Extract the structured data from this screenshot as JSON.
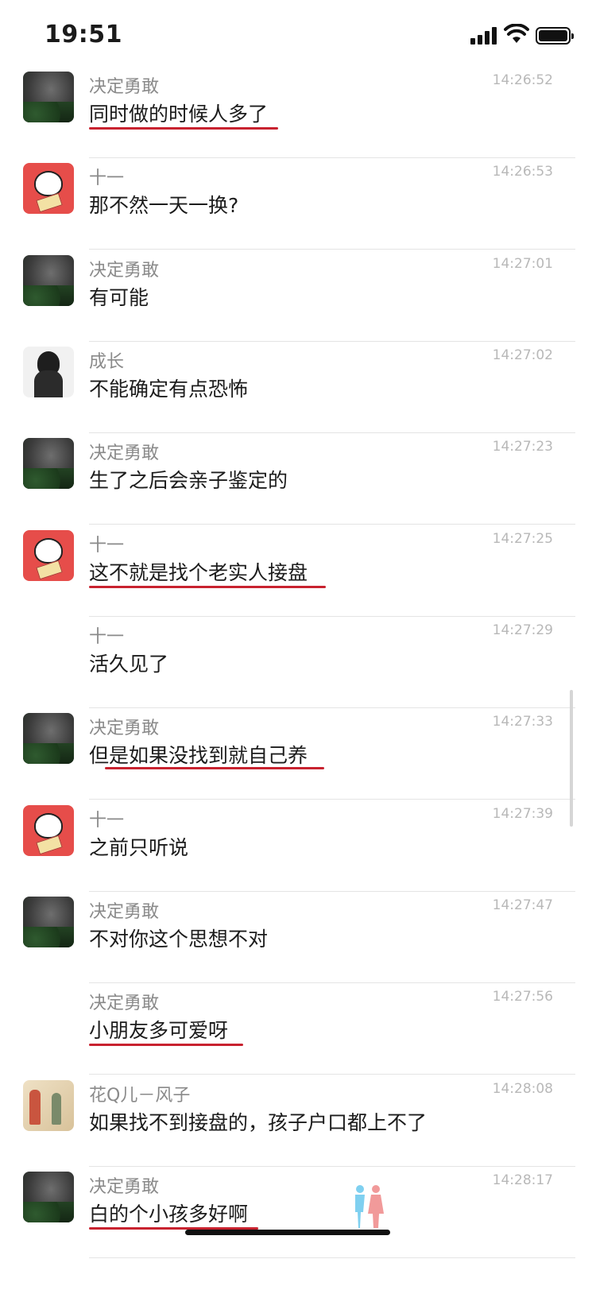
{
  "status": {
    "time": "19:51"
  },
  "messages": [
    {
      "sender": "决定勇敢",
      "time": "14:26:52",
      "text": "同时做的时候人多了",
      "avatar": "night-flower-icon",
      "highlighted": true
    },
    {
      "sender": "十一",
      "time": "14:26:53",
      "text": "那不然一天一换?",
      "avatar": "cartoon-avatar-icon",
      "highlighted": false
    },
    {
      "sender": "决定勇敢",
      "time": "14:27:01",
      "text": "有可能",
      "avatar": "night-flower-icon",
      "highlighted": false
    },
    {
      "sender": "成长",
      "time": "14:27:02",
      "text": "不能确定有点恐怖",
      "avatar": "girl-avatar-icon",
      "highlighted": false
    },
    {
      "sender": "决定勇敢",
      "time": "14:27:23",
      "text": "生了之后会亲子鉴定的",
      "avatar": "night-flower-icon",
      "highlighted": false
    },
    {
      "sender": "十一",
      "time": "14:27:25",
      "text": "这不就是找个老实人接盘",
      "avatar": "cartoon-avatar-icon",
      "highlighted": true
    },
    {
      "sender": "十一",
      "time": "14:27:29",
      "text": "活久见了",
      "avatar": "",
      "highlighted": false
    },
    {
      "sender": "决定勇敢",
      "time": "14:27:33",
      "text": "但是如果没找到就自己养",
      "avatar": "night-flower-icon",
      "highlighted": true
    },
    {
      "sender": "十一",
      "time": "14:27:39",
      "text": "之前只听说",
      "avatar": "cartoon-avatar-icon",
      "highlighted": false
    },
    {
      "sender": "决定勇敢",
      "time": "14:27:47",
      "text": "不对你这个思想不对",
      "avatar": "night-flower-icon",
      "highlighted": false
    },
    {
      "sender": "决定勇敢",
      "time": "14:27:56",
      "text": "小朋友多可爱呀",
      "avatar": "",
      "highlighted": true
    },
    {
      "sender": "花Q儿－风子",
      "time": "14:28:08",
      "text": "如果找不到接盘的，孩子户口都上不了",
      "avatar": "painting-avatar-icon",
      "highlighted": false
    },
    {
      "sender": "决定勇敢",
      "time": "14:28:17",
      "text": "白的个小孩多好啊",
      "avatar": "night-flower-icon",
      "highlighted": true
    }
  ],
  "colors": {
    "underline": "#c8222f",
    "sender": "#8a8a8a",
    "time": "#b8b8b8"
  }
}
